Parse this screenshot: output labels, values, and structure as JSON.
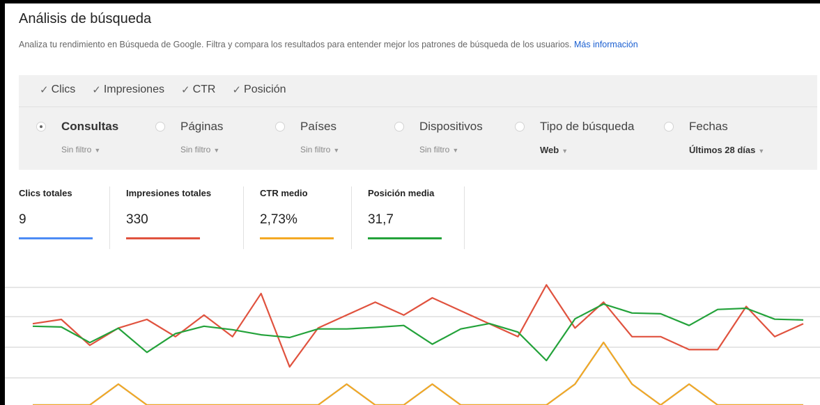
{
  "header": {
    "title": "Análisis de búsqueda",
    "description": "Analiza tu rendimiento en Búsqueda de Google. Filtra y compara los resultados para entender mejor los patrones de búsqueda de los usuarios.",
    "more_link": "Más información"
  },
  "metrics": [
    {
      "label": "Clics",
      "checked": true
    },
    {
      "label": "Impresiones",
      "checked": true
    },
    {
      "label": "CTR",
      "checked": true
    },
    {
      "label": "Posición",
      "checked": true
    }
  ],
  "dimensions": [
    {
      "label": "Consultas",
      "filter": "Sin filtro",
      "selected": true
    },
    {
      "label": "Páginas",
      "filter": "Sin filtro",
      "selected": false
    },
    {
      "label": "Países",
      "filter": "Sin filtro",
      "selected": false
    },
    {
      "label": "Dispositivos",
      "filter": "Sin filtro",
      "selected": false
    },
    {
      "label": "Tipo de búsqueda",
      "filter": "Web",
      "selected": false
    },
    {
      "label": "Fechas",
      "filter": "Últimos 28 días",
      "selected": false
    }
  ],
  "stats": [
    {
      "label": "Clics totales",
      "value": "9",
      "color": "#4c8bf5"
    },
    {
      "label": "Impresiones totales",
      "value": "330",
      "color": "#e0523e"
    },
    {
      "label": "CTR medio",
      "value": "2,73%",
      "color": "#f4a923"
    },
    {
      "label": "Posición media",
      "value": "31,7",
      "color": "#23a23a"
    }
  ],
  "chart_data": {
    "type": "line",
    "x": [
      1,
      2,
      3,
      4,
      5,
      6,
      7,
      8,
      9,
      10,
      11,
      12,
      13,
      14,
      15,
      16,
      17,
      18,
      19,
      20,
      21,
      22,
      23,
      24,
      25,
      26,
      27,
      28
    ],
    "series": [
      {
        "name": "Clics",
        "color": "#4c8bf5",
        "values": [
          0,
          0,
          0,
          1,
          0,
          0,
          0,
          0,
          0,
          0,
          0,
          1,
          0,
          0,
          1,
          0,
          0,
          0,
          0,
          1,
          3,
          1,
          0,
          1,
          0,
          0,
          0,
          0
        ]
      },
      {
        "name": "Impresiones",
        "color": "#e0523e",
        "values": [
          14,
          15,
          9,
          13,
          15,
          11,
          16,
          11,
          21,
          4,
          13,
          16,
          19,
          16,
          20,
          17,
          14,
          11,
          23,
          13,
          19,
          11,
          11,
          8,
          8,
          18,
          11,
          14
        ]
      },
      {
        "name": "CTR",
        "color": "#f4a923",
        "values": [
          0,
          0,
          0,
          1,
          0,
          0,
          0,
          0,
          0,
          0,
          0,
          1,
          0,
          0,
          1,
          0,
          0,
          0,
          0,
          1,
          3,
          1,
          0,
          1,
          0,
          0,
          0,
          0
        ]
      },
      {
        "name": "Posición",
        "color": "#23a23a",
        "values": [
          14.5,
          14.3,
          10.3,
          14.0,
          7.8,
          12.6,
          14.5,
          13.6,
          12.3,
          11.6,
          13.8,
          13.8,
          14.2,
          14.7,
          9.9,
          13.8,
          15.2,
          13.0,
          5.7,
          16.4,
          20.2,
          17.9,
          17.7,
          14.7,
          18.8,
          19.1,
          16.3,
          16.1
        ]
      }
    ]
  }
}
